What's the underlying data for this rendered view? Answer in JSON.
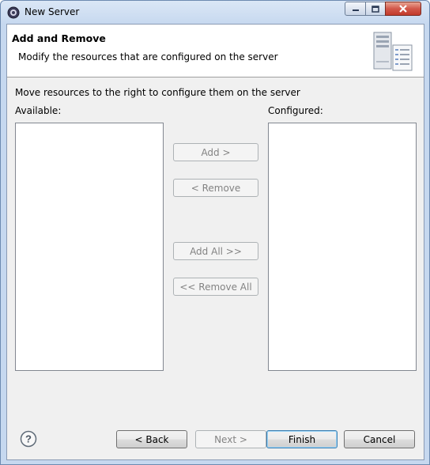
{
  "window": {
    "title": "New Server",
    "icons": {
      "app": "eclipse-server-icon",
      "minimize": "minimize-icon",
      "maximize": "maximize-icon",
      "close": "close-icon"
    }
  },
  "header": {
    "title": "Add and Remove",
    "description": "Modify the resources that are configured on the server",
    "icon": "server-wizard-icon"
  },
  "body": {
    "instruction": "Move resources to the right to configure them on the server",
    "available_label": "Available:",
    "configured_label": "Configured:",
    "available_items": [],
    "configured_items": []
  },
  "transfer_buttons": {
    "add": "Add >",
    "remove": "< Remove",
    "add_all": "Add All >>",
    "remove_all": "<< Remove All"
  },
  "footer": {
    "help_icon": "help-icon",
    "back": "< Back",
    "next": "Next >",
    "finish": "Finish",
    "cancel": "Cancel"
  }
}
